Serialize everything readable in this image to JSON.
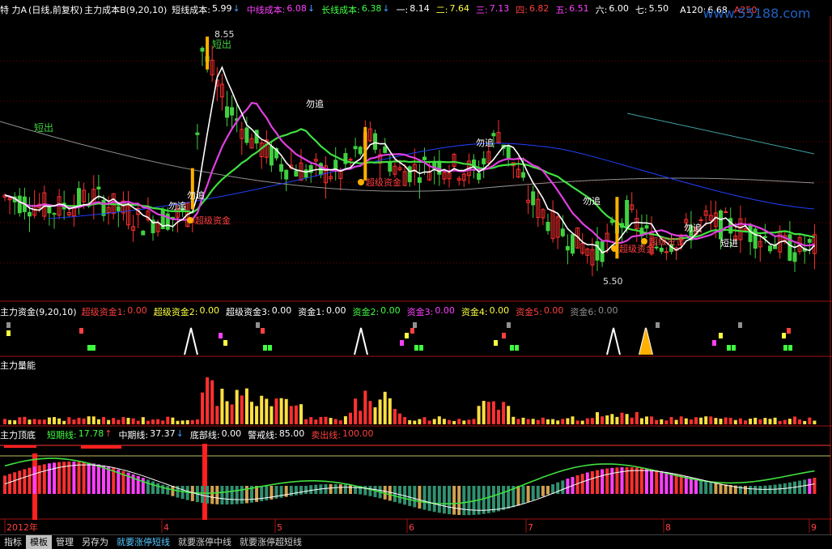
{
  "header": {
    "prefix": "特 力A",
    "period": "(日线,前复权)",
    "indicator": "主力成本B(9,20,10)",
    "items": [
      {
        "label": "短线成本:",
        "value": "5.99",
        "color": "#ffffff",
        "arrow": "↓",
        "arrow_color": "#40a0ff"
      },
      {
        "label": "中线成本:",
        "value": "6.08",
        "color": "#ff40ff",
        "arrow": "↓",
        "arrow_color": "#40a0ff"
      },
      {
        "label": "长线成本:",
        "value": "6.38",
        "color": "#40ff40",
        "arrow": "↓",
        "arrow_color": "#40a0ff"
      },
      {
        "label": "一:",
        "value": "8.14",
        "color": "#ffffff",
        "arrow": "",
        "arrow_color": ""
      },
      {
        "label": "二:",
        "value": "7.64",
        "color": "#ffff40",
        "arrow": "",
        "arrow_color": ""
      },
      {
        "label": "三:",
        "value": "7.13",
        "color": "#ff40ff",
        "arrow": "",
        "arrow_color": ""
      },
      {
        "label": "四:",
        "value": "6.82",
        "color": "#ff4040",
        "arrow": "",
        "arrow_color": ""
      },
      {
        "label": "五:",
        "value": "6.51",
        "color": "#ff40ff",
        "arrow": "",
        "arrow_color": ""
      },
      {
        "label": "六:",
        "value": "6.00",
        "color": "#ffffff",
        "arrow": "",
        "arrow_color": ""
      },
      {
        "label": "七:",
        "value": "5.50",
        "color": "#ffffff",
        "arrow": "",
        "arrow_color": ""
      }
    ],
    "extra": [
      {
        "label": "A120:",
        "value": "6.68",
        "color": "#ffffff"
      },
      {
        "label": "A250:",
        "value": "",
        "color": "#ff4040"
      }
    ],
    "watermark": "www.55188.com"
  },
  "price_panel": {
    "high_label": "8.55",
    "low_label": "5.50",
    "signals": {
      "short_out": "短出",
      "dont_chase": "勿追",
      "super_fund": "超级资金",
      "short_in": "短进"
    }
  },
  "fund_panel": {
    "title": "主力资金(9,20,10)",
    "items": [
      {
        "label": "超级资金1:",
        "value": "0.00",
        "color": "#ff4040"
      },
      {
        "label": "超级资金2:",
        "value": "0.00",
        "color": "#ffff40"
      },
      {
        "label": "超级资金3:",
        "value": "0.00",
        "color": "#ffffff"
      },
      {
        "label": "资金1:",
        "value": "0.00",
        "color": "#ffffff"
      },
      {
        "label": "资金2:",
        "value": "0.00",
        "color": "#40ff40"
      },
      {
        "label": "资金3:",
        "value": "0.00",
        "color": "#ff40ff"
      },
      {
        "label": "资金4:",
        "value": "0.00",
        "color": "#ffff40"
      },
      {
        "label": "资金5:",
        "value": "0.00",
        "color": "#ff4040"
      },
      {
        "label": "资金6:",
        "value": "0.00",
        "color": "#909090"
      }
    ]
  },
  "energy_panel": {
    "title": "主力量能"
  },
  "bottom_panel": {
    "title": "主力顶底",
    "items": [
      {
        "label": "短期线:",
        "value": "17.78",
        "color": "#40ff40",
        "arrow": "↑",
        "arrow_color": "#ff4040"
      },
      {
        "label": "中期线:",
        "value": "37.37",
        "color": "#ffffff",
        "arrow": "↓",
        "arrow_color": "#40a0ff"
      },
      {
        "label": "底部线:",
        "value": "0.00",
        "color": "#ffffff",
        "arrow": "",
        "arrow_color": ""
      },
      {
        "label": "警戒线:",
        "value": "85.00",
        "color": "#ffffff",
        "arrow": "",
        "arrow_color": ""
      },
      {
        "label": "卖出线:",
        "value": "100.00",
        "color": "#ff4040",
        "arrow": "",
        "arrow_color": ""
      }
    ]
  },
  "time_axis": {
    "labels": [
      "2012年",
      "4",
      "5",
      "6",
      "7",
      "8",
      "9"
    ]
  },
  "bottom_tabs": [
    {
      "label": "指标",
      "type": "tab",
      "active": false
    },
    {
      "label": "模板",
      "type": "tab",
      "active": true
    },
    {
      "label": "管理",
      "type": "tab",
      "active": false
    },
    {
      "label": "另存为",
      "type": "tab",
      "active": false
    },
    {
      "label": "就要涨停短线",
      "type": "formula",
      "active": false
    },
    {
      "label": "就要涨停中线",
      "type": "formula-dim",
      "active": false
    },
    {
      "label": "就要涨停超短线",
      "type": "formula-dim",
      "active": false
    }
  ],
  "colors": {
    "up": "#ff3030",
    "down": "#40d040",
    "short_line": "#ffffff",
    "mid_line": "#e040e0",
    "long_line": "#40e040",
    "blue_line": "#2040ff",
    "gray_line": "#909090",
    "cyan_line": "#40a0a0",
    "gold": "#ffb000"
  }
}
